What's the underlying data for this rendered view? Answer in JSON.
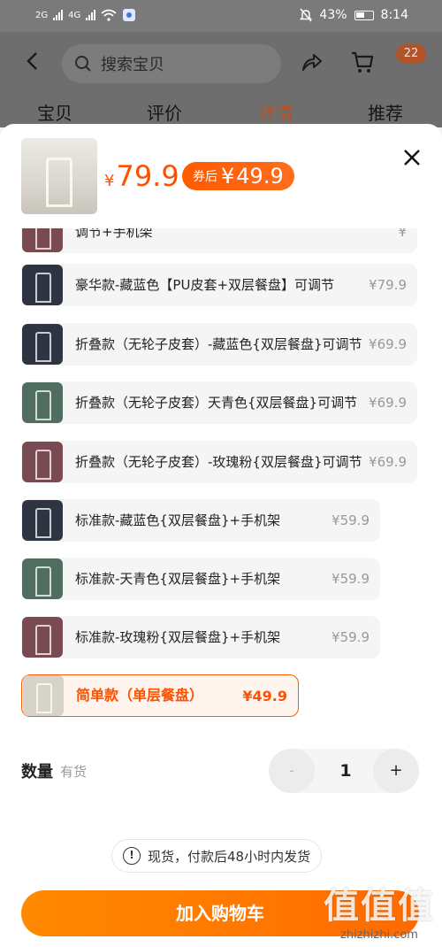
{
  "status": {
    "net1": "2G",
    "net2": "4G",
    "battery": "43%",
    "time": "8:14"
  },
  "header": {
    "search_placeholder": "搜索宝贝",
    "cart_count": "22"
  },
  "tabs": [
    {
      "label": "宝贝"
    },
    {
      "label": "评价"
    },
    {
      "label": "详情"
    },
    {
      "label": "推荐"
    }
  ],
  "sku_panel": {
    "currency": "¥",
    "price": "79.9",
    "coupon_label": "券后",
    "coupon_price": "49.9",
    "options": [
      {
        "name": "调节+手机架",
        "price": "¥",
        "color": "#7a4a52"
      },
      {
        "name": "豪华款-藏蓝色【PU皮套+双层餐盘】可调节",
        "price": "¥79.9",
        "color": "#2f3442"
      },
      {
        "name": "折叠款（无轮子皮套）-藏蓝色{双层餐盘}可调节",
        "price": "¥69.9",
        "color": "#2f3442"
      },
      {
        "name": "折叠款（无轮子皮套）天青色{双层餐盘}可调节",
        "price": "¥69.9",
        "color": "#4f6e60"
      },
      {
        "name": "折叠款（无轮子皮套）-玫瑰粉{双层餐盘}可调节",
        "price": "¥69.9",
        "color": "#7a4a52"
      },
      {
        "name": "标准款-藏蓝色{双层餐盘}+手机架",
        "price": "¥59.9",
        "color": "#2f3442"
      },
      {
        "name": "标准款-天青色{双层餐盘}+手机架",
        "price": "¥59.9",
        "color": "#4f6e60"
      },
      {
        "name": "标准款-玫瑰粉{双层餐盘}+手机架",
        "price": "¥59.9",
        "color": "#7a4a52"
      },
      {
        "name": "简单款（单层餐盘）",
        "price": "¥49.9",
        "color": "#d8d3c8"
      }
    ],
    "quantity_label": "数量",
    "stock": "有货",
    "quantity": "1",
    "minus": "-",
    "plus": "+",
    "notice": "现货，付款后48小时内发货",
    "add_to_cart": "加入购物车"
  },
  "watermark": {
    "big": "值值值",
    "small": "zhizhizhi.com"
  }
}
